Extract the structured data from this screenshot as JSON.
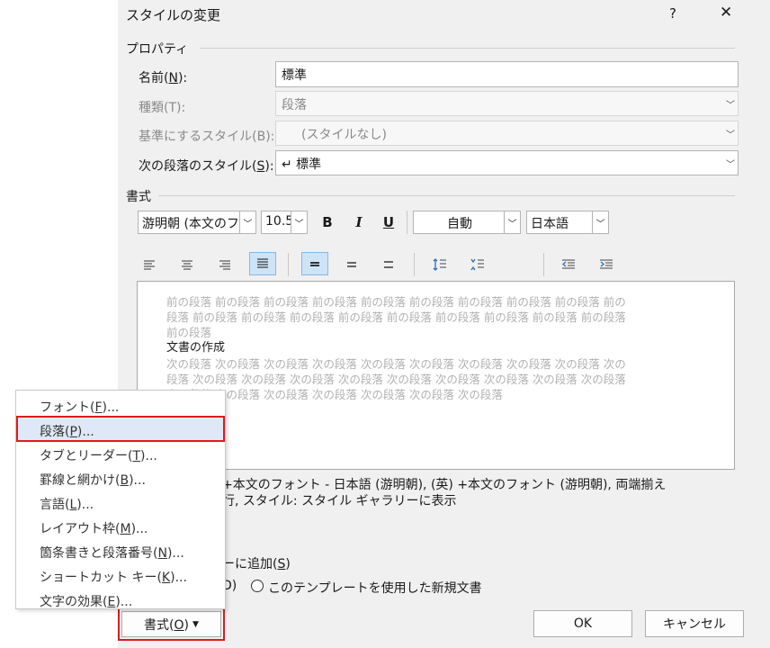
{
  "dialog": {
    "title": "スタイルの変更",
    "help": "?",
    "close": "✕"
  },
  "properties": {
    "section": "プロパティ",
    "name_label": "名前(N):",
    "name_value": "標準",
    "type_label": "種類(T):",
    "type_value": "段落",
    "base_label": "基準にするスタイル(B):",
    "base_value": "(スタイルなし)",
    "next_label": "次の段落のスタイル(S):",
    "next_value": "↵ 標準"
  },
  "formatting": {
    "section": "書式",
    "font": "游明朝 (本文のフ",
    "size": "10.5",
    "bold": "B",
    "italic": "I",
    "underline": "U",
    "color": "自動",
    "language": "日本語"
  },
  "preview": {
    "prev_lines": [
      "前の段落 前の段落 前の段落 前の段落 前の段落 前の段落 前の段落 前の段落 前の段落 前の",
      "段落 前の段落 前の段落 前の段落 前の段落 前の段落 前の段落 前の段落 前の段落 前の段落",
      "前の段落"
    ],
    "sample": "文書の作成",
    "next_lines": [
      "次の段落 次の段落 次の段落 次の段落 次の段落 次の段落 次の段落 次の段落 次の段落 次の",
      "段落 次の段落 次の段落 次の段落 次の段落 次の段落 次の段落 次の段落 次の段落 次の段落",
      "次の段落 次の段落 次の段落 次の段落 次の段落 次の段落 次の段落"
    ]
  },
  "description": {
    "line1": "+本文のフォント - 日本語 (游明朝), (英) +本文のフォント (游明朝), 両端揃え",
    "line2": "行, スタイル: スタイル ギャラリーに表示"
  },
  "options": {
    "add_gallery": "ーに追加(S)",
    "radio1_tail": "D)",
    "radio2": "このテンプレートを使用した新規文書"
  },
  "menu": {
    "items": [
      "フォント(F)...",
      "段落(P)...",
      "タブとリーダー(T)...",
      "罫線と網かけ(B)...",
      "言語(L)...",
      "レイアウト枠(M)...",
      "箇条書きと段落番号(N)...",
      "ショートカット キー(K)...",
      "文字の効果(E)..."
    ]
  },
  "buttons": {
    "format": "書式(O)",
    "ok": "OK",
    "cancel": "キャンセル"
  }
}
